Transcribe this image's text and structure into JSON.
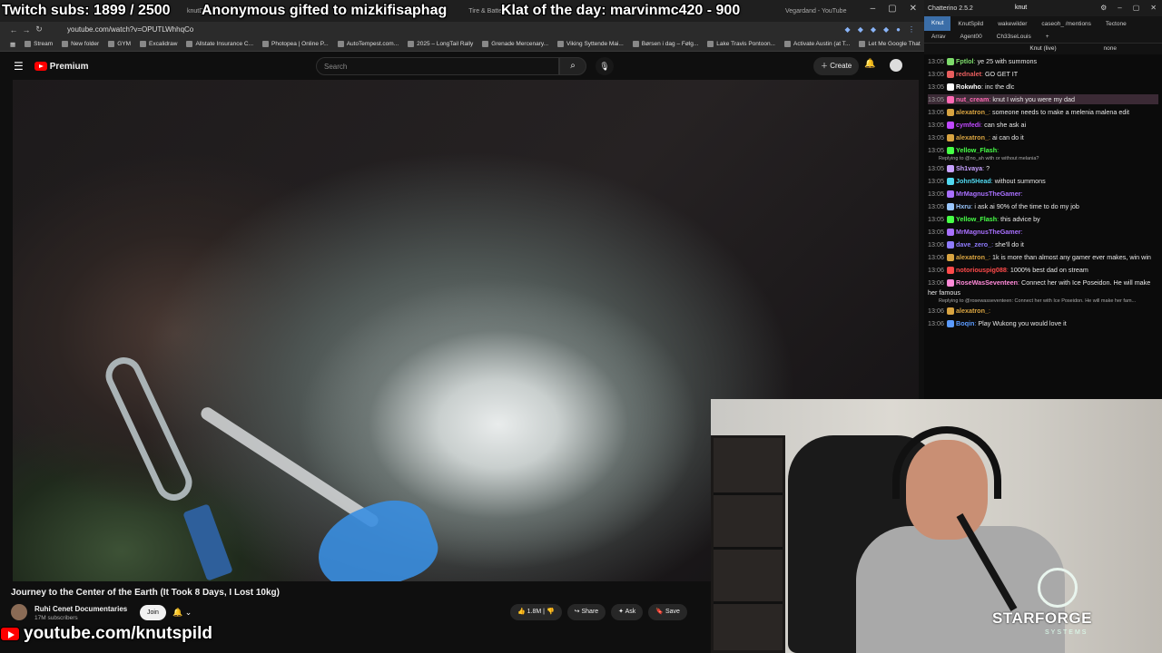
{
  "browser": {
    "tabs": [
      "knutD",
      "Tire & Batte",
      "Vegardand - YouTube"
    ],
    "url": "youtube.com/watch?v=OPUTLWhhqCo",
    "bookmarks": [
      "Stream",
      "New folder",
      "GYM",
      "Excalidraw",
      "Allstate Insurance C...",
      "Photopea | Online P...",
      "AutoTempest.com...",
      "2025 – LongTail Rally",
      "Grenade Mercenary...",
      "Viking Syttende Mai...",
      "Børsen i dag – Følg...",
      "Lake Travis Pontoon...",
      "Activate Austin (at T...",
      "Let Me Google That"
    ]
  },
  "youtube": {
    "brand": "Premium",
    "search_placeholder": "Search",
    "create_label": "Create",
    "video_title": "Journey to the Center of the Earth (It Took 8 Days, I Lost 10kg)",
    "channel_name": "Ruhi Cenet Documentaries",
    "channel_subs": "17M subscribers",
    "join_label": "Join",
    "likes": "1.8M",
    "share_label": "Share",
    "ask_label": "Ask",
    "save_label": "Save"
  },
  "overlay": {
    "subs": "Twitch subs: 1899 / 2500",
    "gift": "Anonymous gifted to mizkifisaphag",
    "klat": "Klat of the day: marvinmc420 - 900",
    "youtube_handle": "youtube.com/knutspild"
  },
  "chat": {
    "app_title": "Chatterino 2.5.2",
    "user": "knut",
    "tabs": [
      "Knut",
      "KnutSpild",
      "wakewilder",
      "caseoh_ /mentions",
      "Tectone"
    ],
    "tabs2": [
      "Arrav",
      "Agent00",
      "Ch33seLouis"
    ],
    "channel": "Knut (live)",
    "mode": "none",
    "messages": [
      {
        "time": "13:05",
        "user": "Fptlol",
        "color": "#7ddb6b",
        "text": "ye 25 with summons"
      },
      {
        "time": "13:05",
        "user": "rednalet",
        "color": "#e85e5e",
        "text": "GO GET IT"
      },
      {
        "time": "13:05",
        "user": "Rokwho",
        "color": "#ffffff",
        "text": "inc the dlc"
      },
      {
        "time": "13:05",
        "user": "nut_cream",
        "color": "#ff69b4",
        "text": "knut I wish you were my dad",
        "highlight": true
      },
      {
        "time": "13:05",
        "user": "alexatron_",
        "color": "#d9a441",
        "text": "someone needs to make a melenia malena edit"
      },
      {
        "time": "13:05",
        "user": "cymfedi",
        "color": "#c048ff",
        "text": "can she ask ai"
      },
      {
        "time": "13:05",
        "user": "alexatron_",
        "color": "#d9a441",
        "text": "ai can do it"
      },
      {
        "time": "13:05",
        "user": "Yellow_Flash",
        "color": "#47ff47",
        "text": ""
      },
      {
        "time": "13:05",
        "user": "Sh1vaya",
        "color": "#c6a0ff",
        "text": "?",
        "reply": "Replying to @no_ah with or without melania?"
      },
      {
        "time": "13:05",
        "user": "John5Head",
        "color": "#51d9f0",
        "text": "without summons"
      },
      {
        "time": "13:05",
        "user": "MrMagnusTheGamer",
        "color": "#a970ff",
        "text": ""
      },
      {
        "time": "13:05",
        "user": "Hxru",
        "color": "#9ac7ff",
        "text": "i ask ai 90% of the time to do my job"
      },
      {
        "time": "13:05",
        "user": "Yellow_Flash",
        "color": "#47ff47",
        "text": "this advice by"
      },
      {
        "time": "13:05",
        "user": "MrMagnusTheGamer",
        "color": "#a970ff",
        "text": ""
      },
      {
        "time": "13:06",
        "user": "dave_zero_",
        "color": "#8f7bff",
        "text": "she'll do it"
      },
      {
        "time": "13:06",
        "user": "alexatron_",
        "color": "#d9a441",
        "text": "1k is more than almost any gamer ever makes, win win"
      },
      {
        "time": "13:06",
        "user": "notoriouspig088",
        "color": "#ff4a4a",
        "text": "1000% best dad on stream"
      },
      {
        "time": "13:06",
        "user": "RoseWasSeventeen",
        "color": "#ff8ad8",
        "text": "Connect her with Ice Poseidon. He will make her famous"
      },
      {
        "time": "13:06",
        "user": "alexatron_",
        "color": "#d9a441",
        "text": "",
        "reply": "Replying to @rosewasseventeen: Connect her with Ice Poseidon. He will make her fam..."
      },
      {
        "time": "13:06",
        "user": "Boqin",
        "color": "#5b9bff",
        "text": "Play Wukong you would love it"
      }
    ]
  },
  "webcam": {
    "logo_main": "STARFORGE",
    "logo_sub": "SYSTEMS"
  }
}
